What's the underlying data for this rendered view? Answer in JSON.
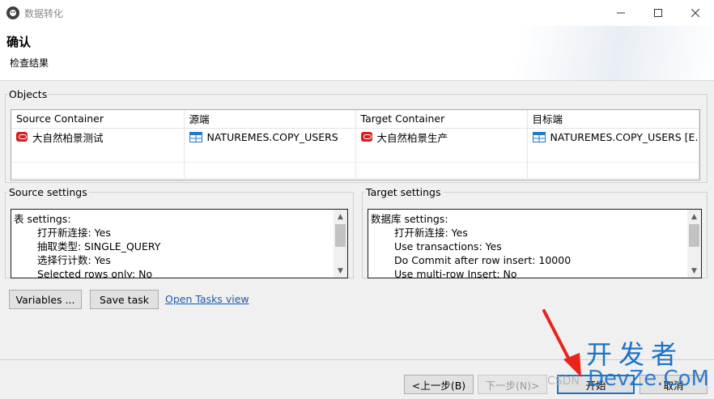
{
  "window": {
    "title": "数据转化",
    "icon": "dbeaver-beaver-icon"
  },
  "header": {
    "title": "确认",
    "subtitle": "检查结果"
  },
  "objects": {
    "legend": "Objects",
    "columns": [
      "Source Container",
      "源端",
      "Target Container",
      "目标端"
    ],
    "rows": [
      {
        "source_container": "大自然柏景测试",
        "source": "NATUREMES.COPY_USERS",
        "target_container": "大自然柏景生产",
        "target": "NATUREMES.COPY_USERS [E..."
      }
    ]
  },
  "source_settings": {
    "legend": "Source settings",
    "lines": [
      {
        "text": "表 settings:",
        "indent": false
      },
      {
        "text": "打开新连接: Yes",
        "indent": true
      },
      {
        "text": "抽取类型: SINGLE_QUERY",
        "indent": true
      },
      {
        "text": "选择行计数: Yes",
        "indent": true
      },
      {
        "text": "Selected rows only: No",
        "indent": true
      }
    ]
  },
  "target_settings": {
    "legend": "Target settings",
    "lines": [
      {
        "text": "数据库 settings:",
        "indent": false
      },
      {
        "text": "打开新连接: Yes",
        "indent": true
      },
      {
        "text": "Use transactions: Yes",
        "indent": true
      },
      {
        "text": "Do Commit after row insert: 10000",
        "indent": true
      },
      {
        "text": "Use multi-row Insert: No",
        "indent": true
      }
    ]
  },
  "actions": {
    "variables": "Variables ...",
    "save_task": "Save task",
    "open_tasks": "Open Tasks view"
  },
  "footer": {
    "back": "<上一步(B)",
    "next": "下一步(N)>",
    "proceed": "开始",
    "cancel": "取消"
  },
  "watermark": {
    "csdn": "CSDN",
    "big": "开发者",
    "url": "DevZe.CoM"
  },
  "colors": {
    "oracle_red": "#d81e1e",
    "table_blue": "#1f7ac9",
    "link": "#1c58b5",
    "annotation_red": "#e8231c",
    "watermark_blue": "#1a73c9"
  }
}
